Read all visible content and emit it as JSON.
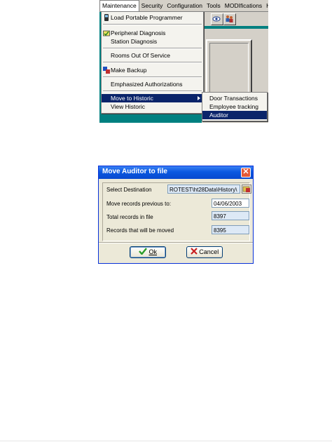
{
  "menubar": {
    "items": [
      {
        "label": "Maintenance",
        "active": true
      },
      {
        "label": "Security"
      },
      {
        "label": "Configuration"
      },
      {
        "label": "Tools"
      },
      {
        "label": "MODIfications"
      },
      {
        "label": "H"
      }
    ]
  },
  "menu": {
    "items": [
      {
        "label": "Load Portable Programmer",
        "icon": "portable-programmer-icon"
      },
      {
        "label": "Peripheral Diagnosis",
        "icon": "diagnosis-icon"
      },
      {
        "label": "Station Diagnosis"
      },
      {
        "label": "Rooms Out Of Service"
      },
      {
        "label": "Make Backup",
        "icon": "backup-icon"
      },
      {
        "label": "Emphasized Authorizations"
      },
      {
        "label": "Move to Historic",
        "highlighted": true,
        "has_submenu": true
      },
      {
        "label": "View Historic"
      }
    ]
  },
  "submenu": {
    "items": [
      {
        "label": "Door Transactions"
      },
      {
        "label": "Employee tracking"
      },
      {
        "label": "Auditor",
        "highlighted": true
      }
    ]
  },
  "dialog": {
    "title": "Move Auditor to file",
    "destination_label": "Select Destination",
    "destination_value": "ROTEST\\ht28Data\\History\\",
    "move_before_label": "Move records previous to:",
    "move_before_value": "04/06/2003",
    "total_label": "Total records in file",
    "total_value": "8397",
    "moved_label": "Records that will be moved",
    "moved_value": "8395",
    "ok_label": "Ok",
    "cancel_label": "Cancel"
  },
  "colors": {
    "desktop_teal": "#008080",
    "menu_highlight": "#0a246a",
    "xp_title_blue": "#0a58e0",
    "xp_close_red": "#e45a38",
    "ok_check_green": "#2a9d2a",
    "cancel_x_red": "#c82020"
  }
}
